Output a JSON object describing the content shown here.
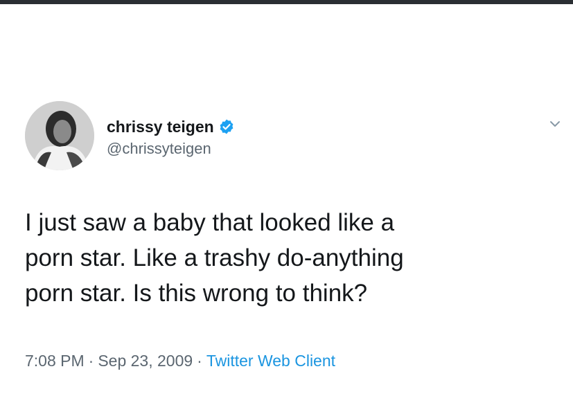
{
  "tweet": {
    "display_name": "chrissy teigen",
    "handle": "@chrissyteigen",
    "verified_icon": "verified-badge-icon",
    "menu_icon": "chevron-down-icon",
    "text": "I just saw a baby that looked like a\nporn star. Like a trashy do-anything\nporn star. Is this wrong to think?",
    "time": "7:08 PM",
    "separator": "·",
    "date": "Sep 23, 2009",
    "client": "Twitter Web Client"
  },
  "colors": {
    "text": "#14171a",
    "secondary": "#5b6670",
    "link": "#1b95e0",
    "verified": "#1da1f2",
    "top_bar": "#2a2e33"
  }
}
